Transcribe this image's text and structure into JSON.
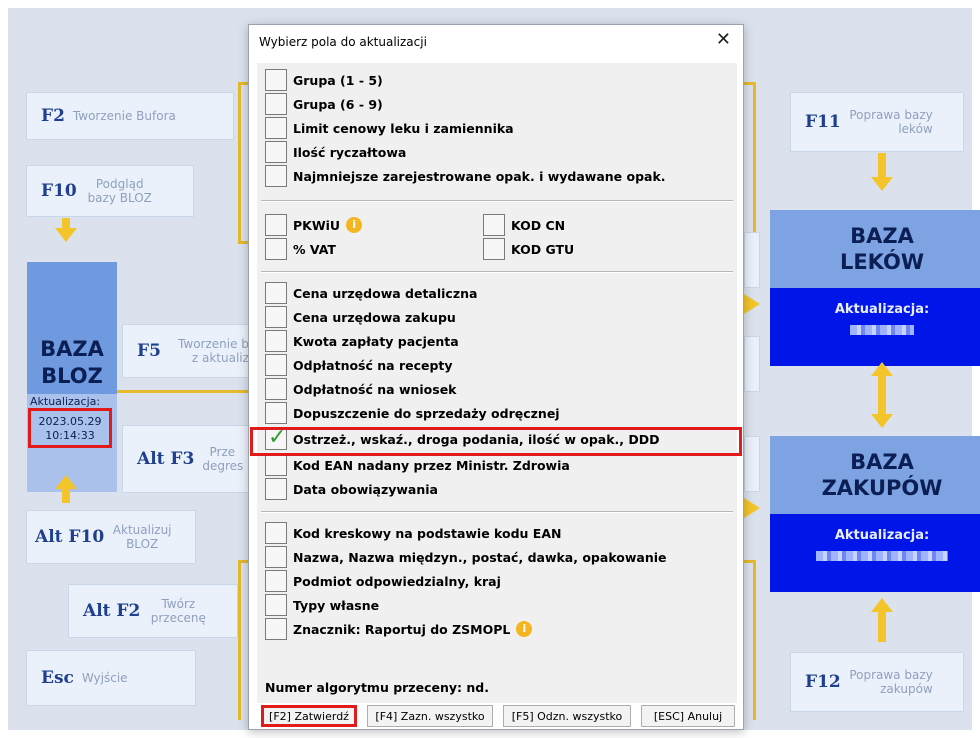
{
  "background": {
    "f2": {
      "key": "F2",
      "desc": "Tworzenie Bufora"
    },
    "f10": {
      "key": "F10",
      "desc": "Podgląd bazy BLOZ"
    },
    "f5": {
      "key": "F5",
      "desc": "Tworzenie b z aktualiz"
    },
    "altf3": {
      "key": "Alt F3",
      "desc": "Prze degres"
    },
    "altf10": {
      "key": "Alt F10",
      "desc": "Aktualizuj BLOZ"
    },
    "altf2": {
      "key": "Alt F2",
      "desc": "Twórz przecenę"
    },
    "esc": {
      "key": "Esc",
      "desc": "Wyjście"
    },
    "f11": {
      "key": "F11",
      "desc": "Poprawa bazy leków"
    },
    "f12": {
      "key": "F12",
      "desc": "Poprawa bazy zakupów"
    },
    "bloz": {
      "line1": "BAZA",
      "line2": "BLOZ",
      "update_label": "Aktualizacja:",
      "date": "2023.05.29",
      "time": "10:14:33"
    },
    "leki": {
      "line1": "BAZA",
      "line2": "LEKÓW",
      "update_label": "Aktualizacja:"
    },
    "zakupy": {
      "line1": "BAZA",
      "line2": "ZAKUPÓW",
      "update_label": "Aktualizacja:"
    }
  },
  "dialog": {
    "title": "Wybierz pola do aktualizacji",
    "close_glyph": "✕",
    "group1": [
      "Grupa (1 - 5)",
      "Grupa (6 - 9)",
      "Limit cenowy leku i zamiennika",
      "Ilość ryczałtowa",
      "Najmniejsze zarejestrowane opak. i wydawane opak."
    ],
    "group2": {
      "pkwiu": "PKWiU",
      "vat": "% VAT",
      "kodcn": "KOD CN",
      "kodgtu": "KOD GTU"
    },
    "group3": [
      "Cena urzędowa detaliczna",
      "Cena urzędowa zakupu",
      "Kwota zapłaty pacjenta",
      "Odpłatność na recepty",
      "Odpłatność na wniosek",
      "Dopuszczenie do sprzedaży odręcznej",
      "Ostrzeż., wskaź., droga podania, ilość w opak., DDD",
      "Kod EAN nadany przez Ministr. Zdrowia",
      "Data obowiązywania"
    ],
    "group4": [
      "Kod kreskowy na podstawie kodu EAN",
      "Nazwa, Nazwa międzyn., postać, dawka, opakowanie",
      "Podmiot odpowiedzialny, kraj",
      "Typy własne",
      "Znacznik: Raportuj do ZSMOPL"
    ],
    "algo_label": "Numer algorytmu przeceny: nd.",
    "info_glyph": "i",
    "buttons": {
      "confirm": "[F2] Zatwierdź",
      "select_all": "[F4] Zazn. wszystko",
      "deselect_all": "[F5] Odzn. wszystko",
      "cancel": "[ESC] Anuluj"
    }
  }
}
